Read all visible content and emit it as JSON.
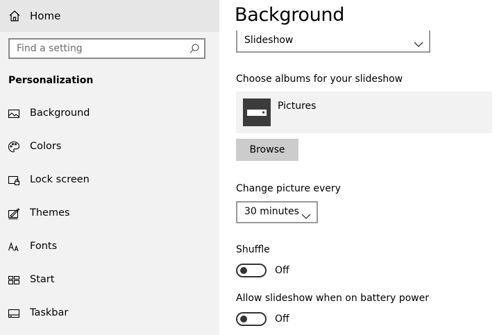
{
  "sidebar": {
    "home_label": "Home",
    "search_placeholder": "Find a setting",
    "section_title": "Personalization",
    "items": [
      {
        "label": "Background",
        "icon": "picture-icon"
      },
      {
        "label": "Colors",
        "icon": "palette-icon"
      },
      {
        "label": "Lock screen",
        "icon": "lock-screen-icon"
      },
      {
        "label": "Themes",
        "icon": "themes-icon"
      },
      {
        "label": "Fonts",
        "icon": "fonts-icon"
      },
      {
        "label": "Start",
        "icon": "start-icon"
      },
      {
        "label": "Taskbar",
        "icon": "taskbar-icon"
      }
    ]
  },
  "main": {
    "title": "Background",
    "background_mode": {
      "selected": "Slideshow"
    },
    "albums": {
      "label": "Choose albums for your slideshow",
      "selected_album": "Pictures",
      "browse_label": "Browse"
    },
    "interval": {
      "label": "Change picture every",
      "selected": "30 minutes"
    },
    "shuffle": {
      "label": "Shuffle",
      "state": "Off"
    },
    "battery": {
      "label": "Allow slideshow when on battery power",
      "state": "Off"
    }
  },
  "colors": {
    "sidebar_bg": "#f2f2f2",
    "home_highlight": "#e6e6e6",
    "button_bg": "#cccccc",
    "album_thumb": "#3c3c3c"
  }
}
